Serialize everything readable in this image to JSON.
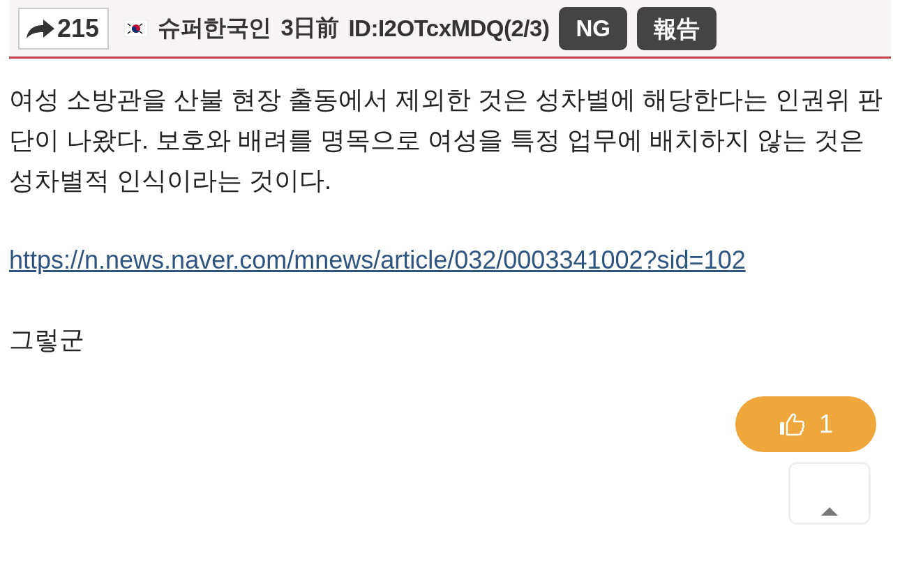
{
  "header": {
    "reply_count": "215",
    "flag": true,
    "name": "슈퍼한국인",
    "time": "3日前",
    "id": "ID:I2OTcxMDQ(2/3)",
    "buttons": [
      "NG",
      "報告"
    ]
  },
  "body": {
    "paragraphs": [
      {
        "kind": "text",
        "text": "여성 소방관을 산불 현장 출동에서 제외한 것은 성차별에 해당한다는 인권위 판단이 나왔다. 보호와 배려를 명목으로 여성을 특정 업무에 배치하지 않는 것은 성차별적 인식이라는 것이다."
      },
      {
        "kind": "link",
        "text": "https://n.news.naver.com/mnews/article/032/0003341002?sid=102"
      },
      {
        "kind": "text",
        "text": "그렇군"
      }
    ]
  },
  "like": {
    "count": "1"
  }
}
